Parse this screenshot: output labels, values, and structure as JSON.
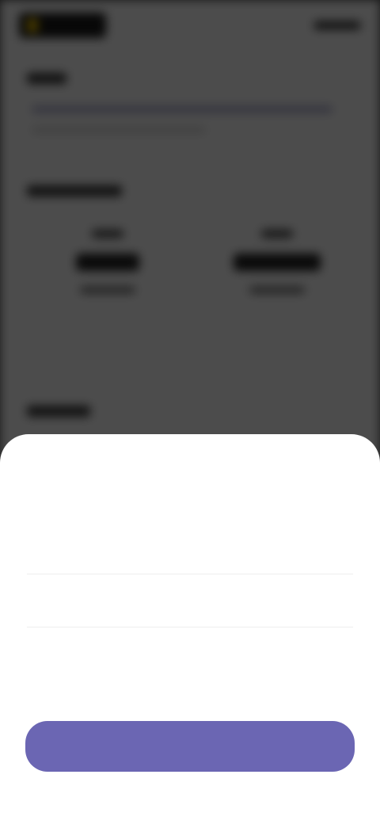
{
  "background": {
    "header": {
      "logo_icon": "logo-icon"
    },
    "sections": [
      {
        "title": ""
      },
      {
        "title": ""
      },
      {
        "title": ""
      }
    ],
    "stats": [
      {
        "label": "",
        "value": "",
        "sub": ""
      },
      {
        "label": "",
        "value": "",
        "sub": ""
      }
    ]
  },
  "sheet": {
    "title": "",
    "picker": {
      "left_options": [
        "",
        "",
        ""
      ],
      "right_options": [
        "",
        "",
        ""
      ],
      "left_selected": "",
      "right_selected": ""
    },
    "confirm_label": ""
  },
  "colors": {
    "accent": "#6b66b3",
    "overlay": "#4a4a4a",
    "sheet": "#ffffff"
  }
}
